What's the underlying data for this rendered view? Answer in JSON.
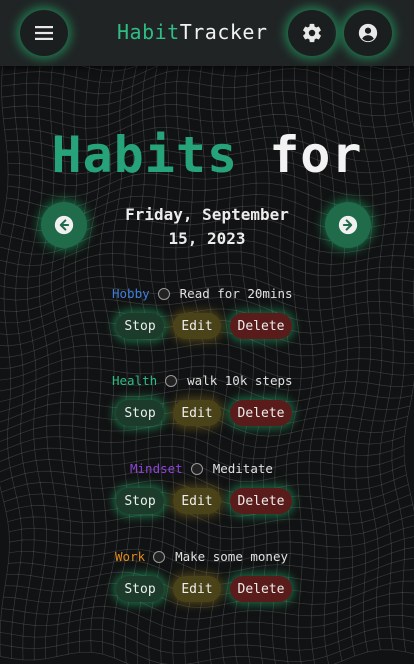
{
  "header": {
    "brand_part1": "Habit",
    "brand_part2": "Tracker",
    "menu_icon": "menu-icon",
    "settings_icon": "gear-icon",
    "account_icon": "user-circle-icon"
  },
  "main": {
    "headline_part1": "Habits",
    "headline_part2": "for",
    "date_line1": "Friday, September",
    "date_line2": "15, 2023",
    "prev_icon": "arrow-left-icon",
    "next_icon": "arrow-right-icon"
  },
  "habits": [
    {
      "category": "Hobby",
      "category_color": "#3f7fdc",
      "name": "Read for 20mins",
      "stop": "Stop",
      "edit": "Edit",
      "delete": "Delete"
    },
    {
      "category": "Health",
      "category_color": "#2ebd85",
      "name": "walk 10k steps",
      "stop": "Stop",
      "edit": "Edit",
      "delete": "Delete"
    },
    {
      "category": "Mindset",
      "category_color": "#8e44d8",
      "name": "Meditate",
      "stop": "Stop",
      "edit": "Edit",
      "delete": "Delete"
    },
    {
      "category": "Work",
      "category_color": "#e08a1e",
      "name": "Make some money",
      "stop": "Stop",
      "edit": "Edit",
      "delete": "Delete"
    }
  ],
  "colors": {
    "accent": "#2ebd85",
    "background": "#111213",
    "topbar": "#202425"
  }
}
